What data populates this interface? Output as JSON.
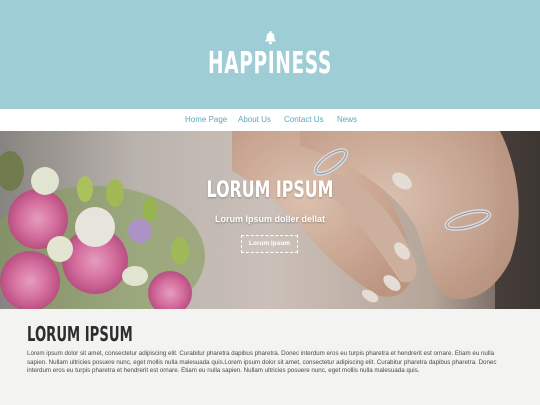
{
  "header": {
    "logo_text": "HAPPINESS"
  },
  "nav": {
    "items": [
      {
        "label": "Home Page"
      },
      {
        "label": "About Us"
      },
      {
        "label": "Contact Us"
      },
      {
        "label": "News"
      }
    ]
  },
  "hero": {
    "title": "LORUM IPSUM",
    "subtitle": "Lorum Ipsum doller dellat",
    "button_label": "Lorum Ipsum"
  },
  "section": {
    "title": "LORUM IPSUM",
    "paragraph": "Lorem ipsum dolor sit amet, consectetur adipiscing elit. Curabitur pharetra dapibus pharetra. Donec interdum eros eu turpis pharetra et hendrerit est ornare. Etiam eu nulla sapien. Nullam ultricies posuere nunc, eget mollis nulla malesuada quis.Lorem ipsum dolor sit amet, consectetur adipiscing elit. Curabitur pharetra dapibus pharetra. Donec interdum eros eu turpis pharetra et hendrerit est ornare. Etiam eu nulla sapien. Nullam ultricies posuere nunc, eget mollis nulla malesuada quis."
  },
  "colors": {
    "header_bg": "#9fcdd6",
    "nav_link": "#5aa9bd",
    "page_bg": "#f3f3f1"
  },
  "icons": {
    "logo_icon": "bell-icon"
  }
}
